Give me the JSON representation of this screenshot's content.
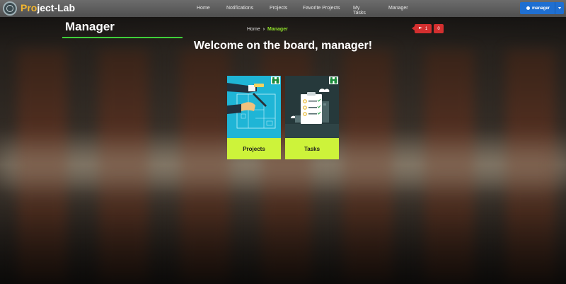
{
  "navbar": {
    "brand_prefix": "Pro",
    "brand_suffix": "ject-Lab",
    "links": [
      {
        "label": "Home"
      },
      {
        "label": "Notifications"
      },
      {
        "label": "Projects"
      },
      {
        "label": "Favorite Projects"
      },
      {
        "label": "My Tasks"
      },
      {
        "label": "Manager"
      }
    ],
    "user_label": "manager",
    "accent_color": "#1f6fd1"
  },
  "header": {
    "title": "Manager",
    "breadcrumb": {
      "home": "Home",
      "separator": "›",
      "current": "Manager"
    },
    "badges": [
      {
        "icon": "flag-icon",
        "count": "1",
        "color": "#d32f2f"
      },
      {
        "count": "0",
        "color": "#d32f2f"
      }
    ]
  },
  "main": {
    "welcome": "Welcome on the board, manager!",
    "cards": [
      {
        "label": "Projects",
        "icon": "blueprint-image",
        "badge_icon": "binoculars-icon"
      },
      {
        "label": "Tasks",
        "icon": "checklist-image",
        "badge_icon": "binoculars-icon"
      }
    ],
    "card_label_color": "#cdf33a"
  }
}
